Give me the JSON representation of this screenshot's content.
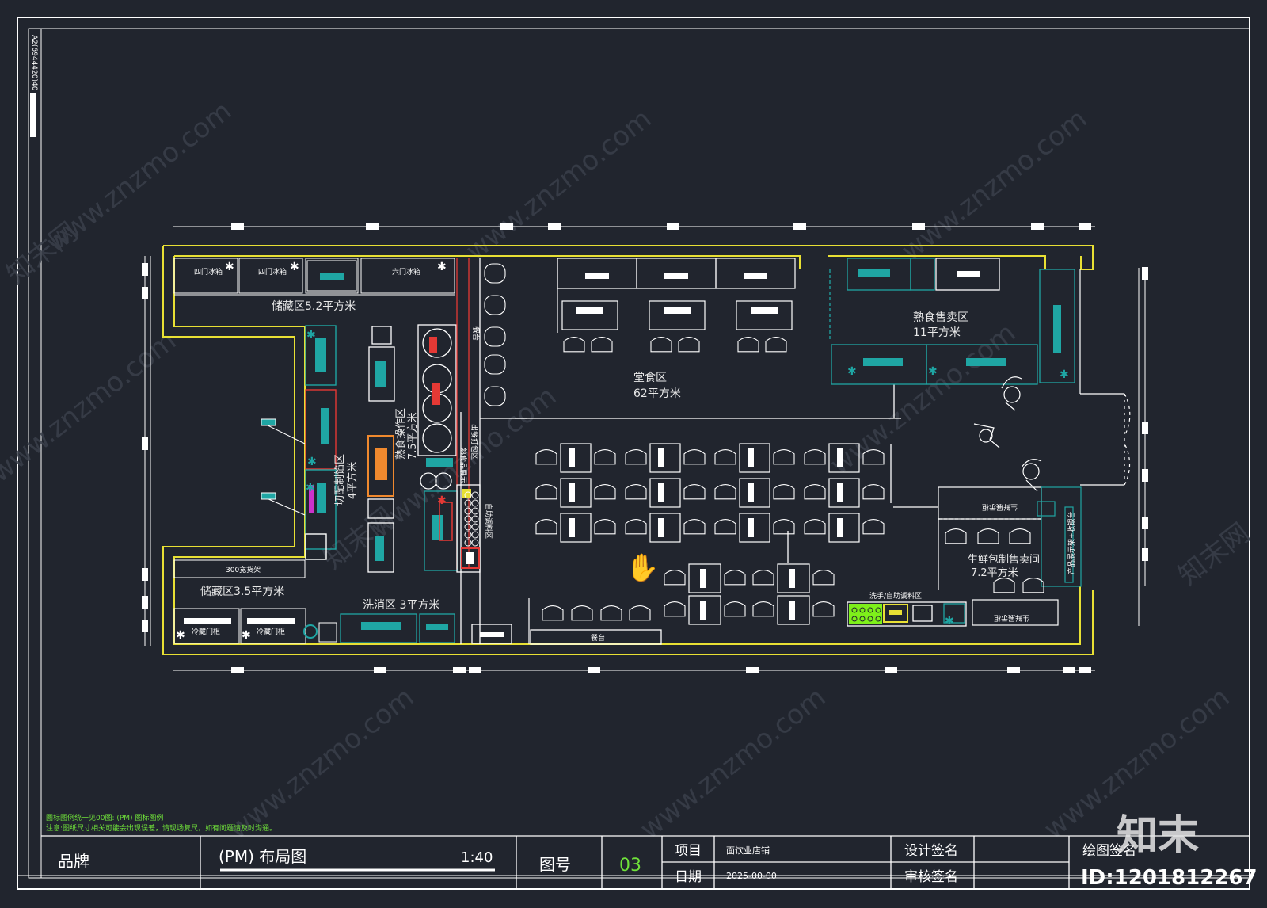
{
  "drawing": {
    "vertical_code": "A2(6944420)40",
    "zones": {
      "storage_top": "储藏区5.2平方米",
      "cut_prep": "切配制馅区",
      "cut_prep_area": "4平方米",
      "cooked_make": "熟食操作区",
      "cooked_make_area": "7.5平方米",
      "dining": "堂食区",
      "dining_area": "62平方米",
      "cooked_sale": "熟食售卖区",
      "cooked_sale_area": "11平方米",
      "fresh_pack": "生鲜包制售卖间",
      "fresh_pack_area": "7.2平方米",
      "storage_bottom": "储藏区3.5平方米",
      "wash": "洗消区 3平方米",
      "wash_hand": "洗手/自助调料区",
      "counter": "餐台",
      "shelf_300": "300宽货架"
    },
    "fridges": {
      "four_door_1": "四门冰箱",
      "four_door_2": "四门冰箱",
      "six_door": "六门冰箱"
    },
    "small_labels": {
      "cabinet_1": "冷藏门柜",
      "cabinet_2": "冷藏门柜",
      "counter_v": "餐台",
      "counter_v2": "出餐打包区",
      "vertical_a": "熟食品展示",
      "vertical_b": "自助调料区",
      "fresh_shelf_top": "生鲜展示柜",
      "fresh_shelf_bottom": "生鲜展示柜",
      "fresh_right": "产品展示架+收银台"
    },
    "notes": {
      "line1": "图标图例统一见00图: (PM) 图标图例",
      "line2": "注意:图纸尺寸相关可能会出现误差，请现场复尺，如有问题请及时沟通。"
    }
  },
  "title_block": {
    "brand_label": "品牌",
    "drawing_name": "(PM) 布局图",
    "scale": "1:40",
    "number_label": "图号",
    "number": "03",
    "project_label": "项目",
    "project_value": "面饮业店铺",
    "date_label": "日期",
    "date_value": "2025-00-00",
    "design_sign": "设计签名",
    "review_sign": "审核签名",
    "draw_sign": "绘图签名"
  },
  "watermark": {
    "site": "www.znzmo.com",
    "brand_cn": "知末网",
    "logo": "知末",
    "id": "ID:1201812267"
  },
  "colors": {
    "background": "#21252e",
    "frame": "#ffffff",
    "wall": "#e8e034",
    "teal": "#1fa6a4",
    "red": "#e53935",
    "orange": "#f0892e",
    "green": "#7ef01a",
    "magenta": "#cc33cc",
    "note_green": "#6fe03a"
  }
}
